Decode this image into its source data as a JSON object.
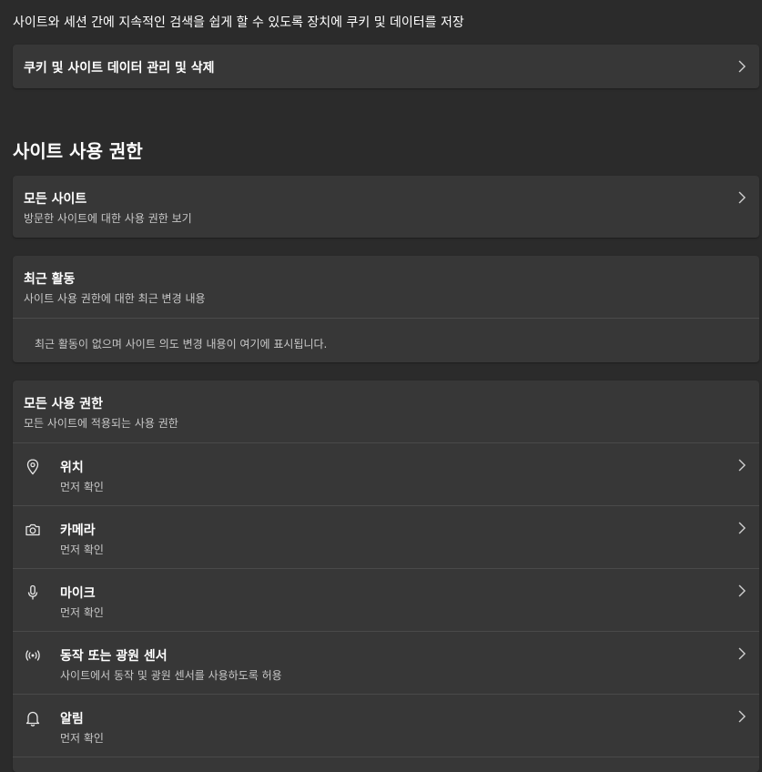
{
  "intro": {
    "text": "사이트와 세션 간에 지속적인 검색을 쉽게 할 수 있도록 장치에 쿠키 및 데이터를 저장"
  },
  "cookies_row": {
    "label": "쿠키 및 사이트 데이터 관리 및 삭제",
    "icon": "chevron-right-icon"
  },
  "section": {
    "title": "사이트 사용 권한"
  },
  "all_sites": {
    "title": "모든 사이트",
    "subtitle": "방문한 사이트에 대한 사용 권한 보기",
    "icon": "chevron-right-icon"
  },
  "recent_activity": {
    "title": "최근 활동",
    "subtitle": "사이트 사용 권한에 대한 최근 변경 내용",
    "empty_message": "최근 활동이 없으며 사이트 의도 변경 내용이 여기에 표시됩니다."
  },
  "all_permissions": {
    "title": "모든 사용 권한",
    "subtitle": "모든 사이트에 적용되는 사용 권한",
    "items": [
      {
        "label": "위치",
        "status": "먼저 확인",
        "icon": "location-pin-icon"
      },
      {
        "label": "카메라",
        "status": "먼저 확인",
        "icon": "camera-icon"
      },
      {
        "label": "마이크",
        "status": "먼저 확인",
        "icon": "microphone-icon"
      },
      {
        "label": "동작 또는 광원 센서",
        "status": "사이트에서 동작 및 광원 센서를 사용하도록 허용",
        "icon": "sensor-icon"
      },
      {
        "label": "알림",
        "status": "먼저 확인",
        "icon": "bell-icon"
      }
    ]
  },
  "colors": {
    "background": "#2b2b2b",
    "card": "#373737",
    "divider": "#4a4a4a",
    "text_primary": "#ffffff",
    "text_secondary": "#c8c8c8"
  }
}
